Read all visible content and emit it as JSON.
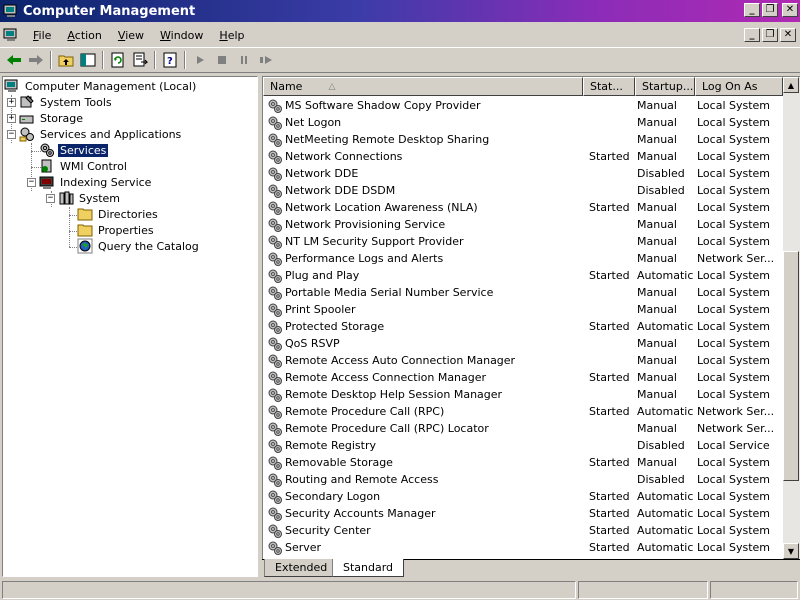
{
  "window": {
    "title": "Computer Management",
    "controls": {
      "minimize": "_",
      "restore": "❐",
      "close": "✕"
    }
  },
  "menu": {
    "items": [
      {
        "accel": "F",
        "rest": "ile"
      },
      {
        "accel": "A",
        "rest": "ction"
      },
      {
        "accel": "V",
        "rest": "iew"
      },
      {
        "accel": "W",
        "rest": "indow"
      },
      {
        "accel": "H",
        "rest": "elp"
      }
    ]
  },
  "toolbar": {
    "buttons": [
      "back-icon",
      "forward-icon",
      "up-folder-icon",
      "show-tree-icon",
      "refresh-icon",
      "export-list-icon",
      "help-icon",
      "start-service-icon",
      "stop-service-icon",
      "pause-service-icon",
      "restart-service-icon"
    ]
  },
  "tree": {
    "root": "Computer Management (Local)",
    "system_tools": "System Tools",
    "storage": "Storage",
    "services_apps": "Services and Applications",
    "services": "Services",
    "wmi": "WMI Control",
    "indexing": "Indexing Service",
    "system": "System",
    "directories": "Directories",
    "properties": "Properties",
    "query": "Query the Catalog"
  },
  "list": {
    "columns": {
      "name": "Name",
      "status": "Stat...",
      "startup": "Startup...",
      "logon": "Log On As"
    },
    "rows": [
      {
        "name": "MS Software Shadow Copy Provider",
        "status": "",
        "startup": "Manual",
        "logon": "Local System"
      },
      {
        "name": "Net Logon",
        "status": "",
        "startup": "Manual",
        "logon": "Local System"
      },
      {
        "name": "NetMeeting Remote Desktop Sharing",
        "status": "",
        "startup": "Manual",
        "logon": "Local System"
      },
      {
        "name": "Network Connections",
        "status": "Started",
        "startup": "Manual",
        "logon": "Local System"
      },
      {
        "name": "Network DDE",
        "status": "",
        "startup": "Disabled",
        "logon": "Local System"
      },
      {
        "name": "Network DDE DSDM",
        "status": "",
        "startup": "Disabled",
        "logon": "Local System"
      },
      {
        "name": "Network Location Awareness (NLA)",
        "status": "Started",
        "startup": "Manual",
        "logon": "Local System"
      },
      {
        "name": "Network Provisioning Service",
        "status": "",
        "startup": "Manual",
        "logon": "Local System"
      },
      {
        "name": "NT LM Security Support Provider",
        "status": "",
        "startup": "Manual",
        "logon": "Local System"
      },
      {
        "name": "Performance Logs and Alerts",
        "status": "",
        "startup": "Manual",
        "logon": "Network Ser..."
      },
      {
        "name": "Plug and Play",
        "status": "Started",
        "startup": "Automatic",
        "logon": "Local System"
      },
      {
        "name": "Portable Media Serial Number Service",
        "status": "",
        "startup": "Manual",
        "logon": "Local System"
      },
      {
        "name": "Print Spooler",
        "status": "",
        "startup": "Manual",
        "logon": "Local System"
      },
      {
        "name": "Protected Storage",
        "status": "Started",
        "startup": "Automatic",
        "logon": "Local System"
      },
      {
        "name": "QoS RSVP",
        "status": "",
        "startup": "Manual",
        "logon": "Local System"
      },
      {
        "name": "Remote Access Auto Connection Manager",
        "status": "",
        "startup": "Manual",
        "logon": "Local System"
      },
      {
        "name": "Remote Access Connection Manager",
        "status": "Started",
        "startup": "Manual",
        "logon": "Local System"
      },
      {
        "name": "Remote Desktop Help Session Manager",
        "status": "",
        "startup": "Manual",
        "logon": "Local System"
      },
      {
        "name": "Remote Procedure Call (RPC)",
        "status": "Started",
        "startup": "Automatic",
        "logon": "Network Ser..."
      },
      {
        "name": "Remote Procedure Call (RPC) Locator",
        "status": "",
        "startup": "Manual",
        "logon": "Network Ser..."
      },
      {
        "name": "Remote Registry",
        "status": "",
        "startup": "Disabled",
        "logon": "Local Service"
      },
      {
        "name": "Removable Storage",
        "status": "Started",
        "startup": "Manual",
        "logon": "Local System"
      },
      {
        "name": "Routing and Remote Access",
        "status": "",
        "startup": "Disabled",
        "logon": "Local System"
      },
      {
        "name": "Secondary Logon",
        "status": "Started",
        "startup": "Automatic",
        "logon": "Local System"
      },
      {
        "name": "Security Accounts Manager",
        "status": "Started",
        "startup": "Automatic",
        "logon": "Local System"
      },
      {
        "name": "Security Center",
        "status": "Started",
        "startup": "Automatic",
        "logon": "Local System"
      },
      {
        "name": "Server",
        "status": "Started",
        "startup": "Automatic",
        "logon": "Local System"
      }
    ]
  },
  "tabs": {
    "extended": "Extended",
    "standard": "Standard",
    "active": "Standard"
  },
  "colors": {
    "titlebar_start": "#0a246a",
    "titlebar_end": "#b02ab2",
    "selection": "#0a246a",
    "face": "#d4d0c8"
  }
}
